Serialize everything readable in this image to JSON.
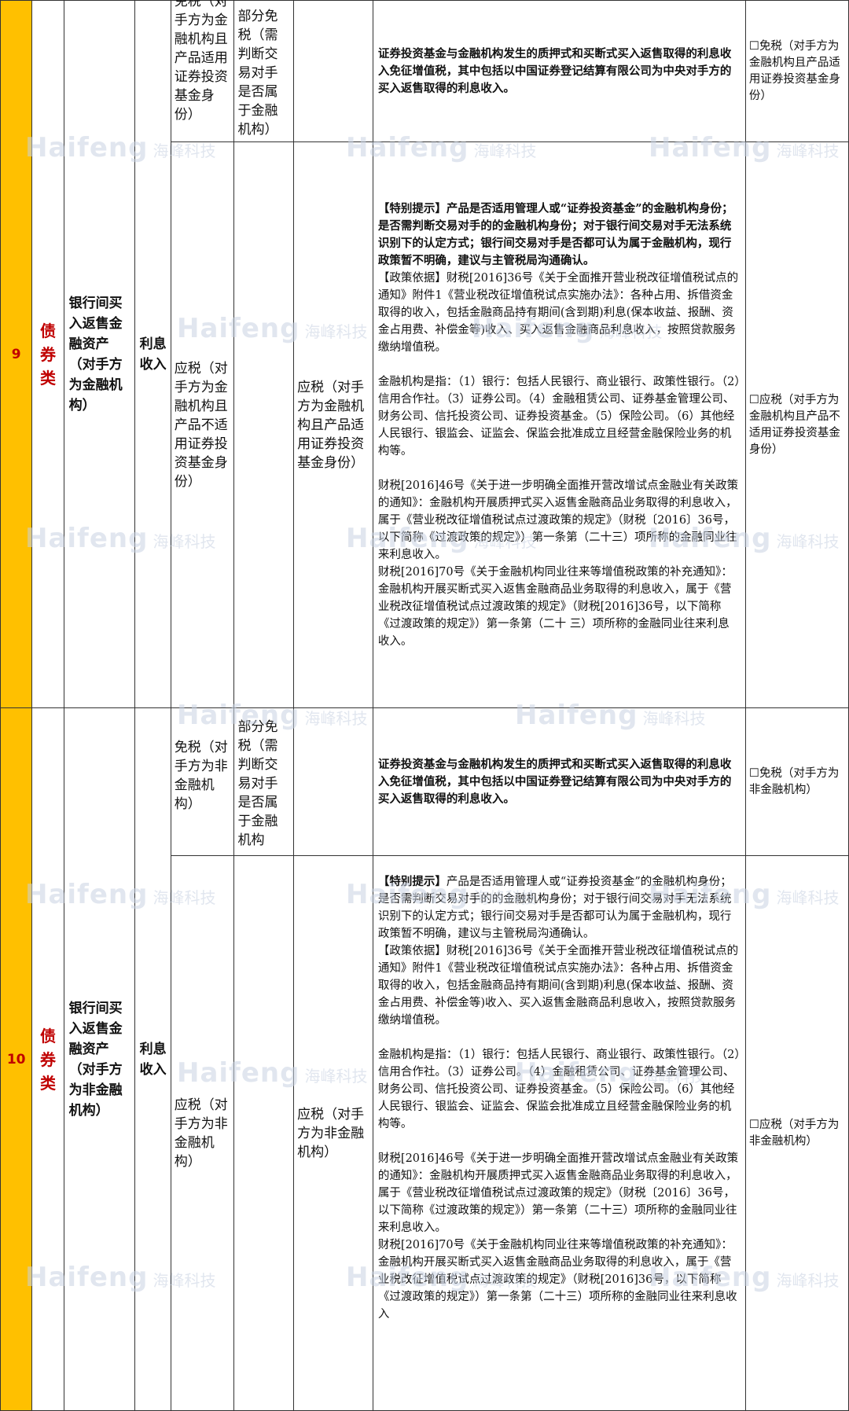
{
  "rows": [
    {
      "no": "9",
      "category": "债券类",
      "asset": "银行间买入返售金融资产（对手方为金融机构）",
      "income_type": "利息收入",
      "sub": [
        {
          "c5": "免税（对手方为金融机构且产品适用证券投资基金身份）",
          "c6": "部分免税（需判断交易对手是否属于金融机构）",
          "c7": "",
          "c8_bold": "证券投资基金与金融机构发生的质押式和买断式买入返售取得的利息收入免征增值税，其中包括以中国证券登记结算有限公司为中央对手方的买入返售取得的利息收入。",
          "c9": "☐免税（对手方为金融机构且产品适用证券投资基金身份）"
        },
        {
          "c5": "应税（对手方为金融机构且产品不适用证券投资基金身份）",
          "c6": "",
          "c7": "应税（对手方为金融机构且产品适用证券投资基金身份）",
          "tip": "【特别提示】产品是否适用管理人或“证券投资基金”的金融机构身份；是否需判断交易对手的的金融机构身份；对于银行间交易对手无法系统识别下的认定方式；银行间交易对手是否都可认为属于金融机构，现行政策暂不明确，建议与主管税局沟通确认。",
          "basis": "【政策依据】财税[2016]36号《关于全面推开营业税改征增值税试点的通知》附件1《营业税改征增值税试点实施办法》：各种占用、拆借资金取得的收入，包括金融商品持有期间(含到期)利息(保本收益、报酬、资金占用费、补偿金等)收入、买入返售金融商品利息收入，按照贷款服务缴纳增值税。",
          "institutions": "金融机构是指：（1）银行：包括人民银行、商业银行、政策性银行。（2）信用合作社。（3）证券公司。（4）金融租赁公司、证券基金管理公司、财务公司、信托投资公司、证券投资基金。（5）保险公司。（6）其他经人民银行、银监会、证监会、保监会批准成立且经营金融保险业务的机构等。",
          "doc46": "财税[2016]46号《关于进一步明确全面推开营改增试点金融业有关政策的通知》：金融机构开展质押式买入返售金融商品业务取得的利息收入，属于《营业税改征增值税试点过渡政策的规定》（财税〔2016〕36号，以下简称《过渡政策的规定》）第一条第（二十三）项所称的金融同业往来利息收入。",
          "doc70": "财税[2016]70号《关于金融机构同业往来等增值税政策的补充通知》：金融机构开展买断式买入返售金融商品业务取得的利息收入，属于《营业税改征增值税试点过渡政策的规定》（财税[2016]36号，以下简称《过渡政策的规定》）第一条第（二十 三）项所称的金融同业往来利息收入。",
          "c9": "☐应税（对手方为金融机构且产品不适用证券投资基金身份）"
        }
      ]
    },
    {
      "no": "10",
      "category": "债券类",
      "asset": "银行间买入返售金融资产（对手方为非金融机构）",
      "income_type": "利息收入",
      "sub": [
        {
          "c5": "免税（对手方为非金融机构）",
          "c6": "部分免税（需判断交易对手是否属于金融机构",
          "c7": "",
          "c8_bold": "证券投资基金与金融机构发生的质押式和买断式买入返售取得的利息收入免征增值税，其中包括以中国证券登记结算有限公司为中央对手方的买入返售取得的利息收入。",
          "c9": "☐免税（对手方为非金融机构）"
        },
        {
          "c5": "应税（对手方为非金融机构）",
          "c6": "",
          "c7": "应税（对手方为非金融机构）",
          "tip": "【特别提示】产品是否适用管理人或“证券投资基金”的金融机构身份；是否需判断交易对手的的金融机构身份；对于银行间交易对手无法系统识别下的认定方式；银行间交易对手是否都可认为属于金融机构，现行政策暂不明确，建议与主管税局沟通确认。",
          "basis": "【政策依据】财税[2016]36号《关于全面推开营业税改征增值税试点的通知》附件1《营业税改征增值税试点实施办法》：各种占用、拆借资金取得的收入，包括金融商品持有期间(含到期)利息(保本收益、报酬、资金占用费、补偿金等)收入、买入返售金融商品利息收入，按照贷款服务缴纳增值税。",
          "institutions": "金融机构是指：（1）银行：包括人民银行、商业银行、政策性银行。（2）信用合作社。（3）证券公司。（4）金融租赁公司、证券基金管理公司、财务公司、信托投资公司、证券投资基金。（5）保险公司。（6）其他经人民银行、银监会、证监会、保监会批准成立且经营金融保险业务的机构等。",
          "doc46": "财税[2016]46号《关于进一步明确全面推开营改增试点金融业有关政策的通知》：金融机构开展质押式买入返售金融商品业务取得的利息收入，属于《营业税改征增值税试点过渡政策的规定》（财税〔2016〕36号，以下简称《过渡政策的规定》）第一条第（二十三）项所称的金融同业往来利息收入。",
          "doc70": "财税[2016]70号《关于金融机构同业往来等增值税政策的补充通知》：金融机构开展买断式买入返售金融商品业务取得的利息收入，属于《营业税改征增值税试点过渡政策的规定》（财税[2016]36号，以下简称《过渡政策的规定》）第一条第（二十三）项所称的金融同业往来利息收入",
          "c9": "☐应税（对手方为非金融机构）"
        }
      ]
    }
  ],
  "watermark": {
    "en": "Haifeng",
    "cn": "海峰科技"
  }
}
